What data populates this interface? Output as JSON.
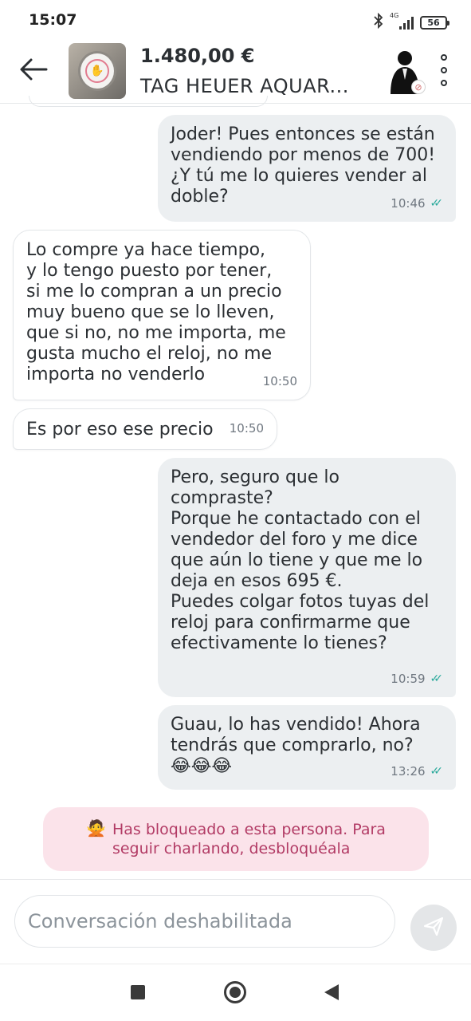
{
  "status_bar": {
    "time": "15:07",
    "network": "4G",
    "battery": "56",
    "icons": [
      "bluetooth-icon",
      "signal-icon",
      "battery-icon"
    ]
  },
  "header": {
    "price": "1.480,00 €",
    "title": "TAG HEUER AQUAR...",
    "icons": [
      "back-arrow-icon",
      "product-thumbnail",
      "seller-avatar",
      "more-vertical-icon"
    ]
  },
  "messages": [
    {
      "direction": "out",
      "text": "Joder! Pues entonces se están\nvendiendo por menos de 700!\n¿Y tú me lo quieres vender al\ndoble?",
      "time": "10:46",
      "read": true
    },
    {
      "direction": "in",
      "text": "Lo compre ya hace tiempo,\ny lo tengo puesto por tener,\nsi me lo compran a un precio\nmuy bueno que se lo lleven,\nque si no, no me importa, me\ngusta mucho el reloj, no me\nimporta no venderlo",
      "time": "10:50"
    },
    {
      "direction": "in",
      "text": "Es por eso ese precio",
      "time": "10:50"
    },
    {
      "direction": "out",
      "text": "Pero, seguro que lo\ncompraste?\nPorque he contactado con el\nvendedor del foro y me dice\nque aún lo tiene y que me lo\ndeja en esos 695 €.\nPuedes colgar fotos tuyas del\nreloj para confirmarme  que\nefectivamente lo tienes?",
      "time": "10:59",
      "read": true
    },
    {
      "direction": "out",
      "text": "Guau, lo has vendido! Ahora\ntendrás que comprarlo, no?\n😂😂😂",
      "time": "13:26",
      "read": true
    }
  ],
  "blocked_notice": {
    "emoji": "🙅",
    "text": "Has bloqueado a esta persona. Para\nseguir charlando, desbloquéala"
  },
  "composer": {
    "placeholder": "Conversación deshabilitada"
  },
  "colors": {
    "outgoing_bubble": "#eceff1",
    "check_mark": "#29a99b",
    "blocked_bg": "#fbe3ea",
    "blocked_text": "#b23b65"
  }
}
